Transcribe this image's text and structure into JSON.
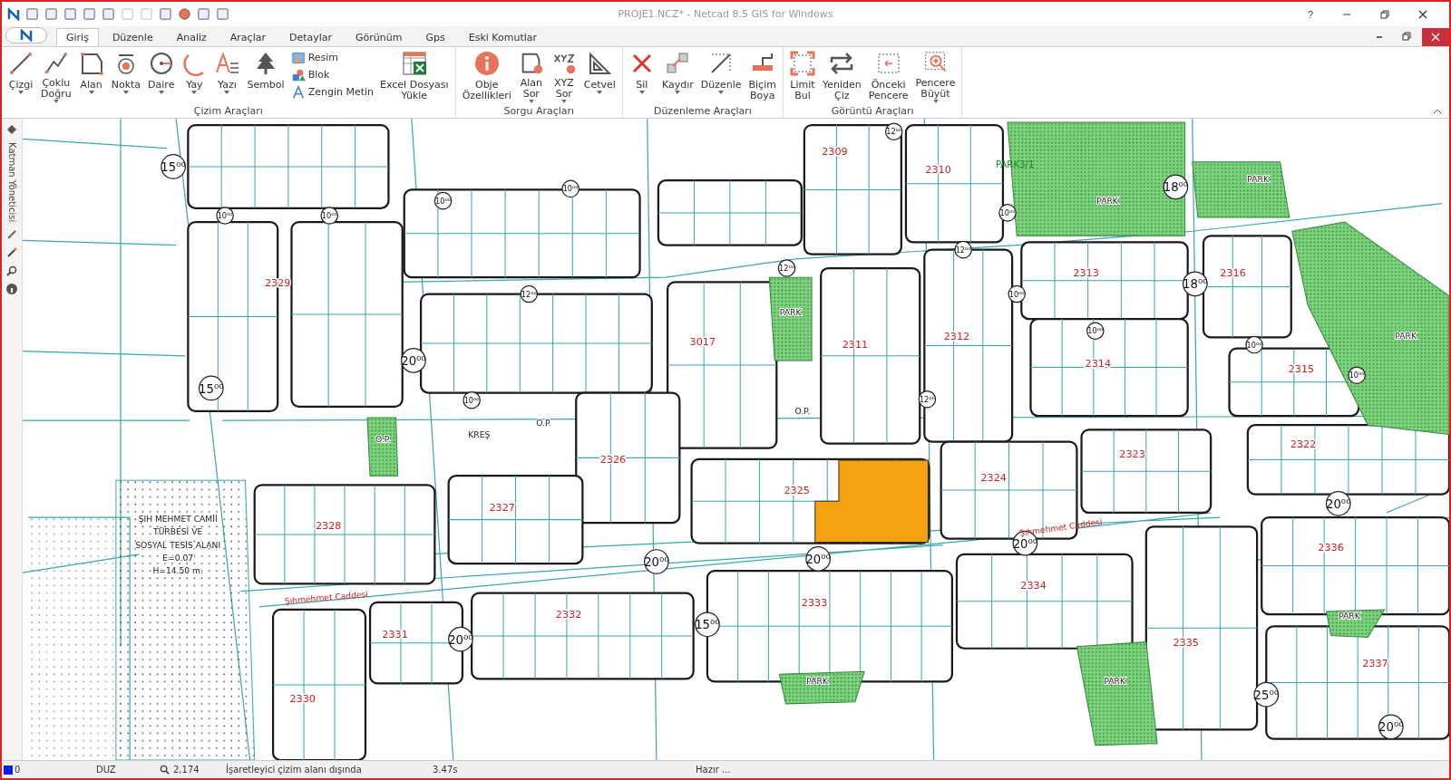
{
  "window": {
    "title": "PROJE1.NCZ* - Netcad 8.5 GIS for Windows",
    "help": "?"
  },
  "tabs": [
    {
      "label": "Giriş",
      "selected": true
    },
    {
      "label": "Düzenle",
      "selected": false
    },
    {
      "label": "Analiz",
      "selected": false
    },
    {
      "label": "Araçlar",
      "selected": false
    },
    {
      "label": "Detaylar",
      "selected": false
    },
    {
      "label": "Görünüm",
      "selected": false
    },
    {
      "label": "Gps",
      "selected": false
    },
    {
      "label": "Eski Komutlar",
      "selected": false
    }
  ],
  "ribbon": [
    {
      "label": "Çizim Araçları",
      "tools": [
        {
          "kind": "large",
          "lines": [
            "Çizgi"
          ],
          "dropdown": true
        },
        {
          "kind": "large",
          "lines": [
            "Çoklu",
            "Doğru"
          ],
          "dropdown": true
        },
        {
          "kind": "large",
          "lines": [
            "Alan"
          ],
          "dropdown": true
        },
        {
          "kind": "large",
          "lines": [
            "Nokta"
          ],
          "dropdown": true
        },
        {
          "kind": "large",
          "lines": [
            "Daire"
          ],
          "dropdown": true
        },
        {
          "kind": "large",
          "lines": [
            "Yay"
          ],
          "dropdown": true
        },
        {
          "kind": "large",
          "lines": [
            "Yazı"
          ],
          "dropdown": true
        },
        {
          "kind": "large",
          "lines": [
            "Sembol"
          ],
          "dropdown": false
        },
        {
          "kind": "small",
          "lines": [
            "Resim"
          ],
          "dropdown": false
        },
        {
          "kind": "small",
          "lines": [
            "Blok"
          ],
          "dropdown": false
        },
        {
          "kind": "small",
          "lines": [
            "Zengin Metin"
          ],
          "dropdown": false
        },
        {
          "kind": "large",
          "lines": [
            "Excel Dosyası",
            "Yükle"
          ],
          "dropdown": false
        }
      ]
    },
    {
      "label": "Sorgu Araçları",
      "tools": [
        {
          "kind": "large",
          "lines": [
            "Obje",
            "Özellikleri"
          ],
          "dropdown": false
        },
        {
          "kind": "large",
          "lines": [
            "Alan",
            "Sor"
          ],
          "dropdown": true
        },
        {
          "kind": "large",
          "lines": [
            "XYZ",
            "Sor"
          ],
          "dropdown": true
        },
        {
          "kind": "large",
          "lines": [
            "Cetvel"
          ],
          "dropdown": true
        }
      ]
    },
    {
      "label": "Düzenleme Araçları",
      "tools": [
        {
          "kind": "large",
          "lines": [
            "Sil"
          ],
          "dropdown": true
        },
        {
          "kind": "large",
          "lines": [
            "Kaydır"
          ],
          "dropdown": true
        },
        {
          "kind": "large",
          "lines": [
            "Düzenle"
          ],
          "dropdown": true
        },
        {
          "kind": "large",
          "lines": [
            "Biçim",
            "Boya"
          ],
          "dropdown": false
        }
      ]
    },
    {
      "label": "Görüntü Araçları",
      "tools": [
        {
          "kind": "large",
          "lines": [
            "Limit",
            "Bul"
          ],
          "dropdown": false
        },
        {
          "kind": "large",
          "lines": [
            "Yeniden",
            "Çiz"
          ],
          "dropdown": false
        },
        {
          "kind": "large",
          "lines": [
            "Önceki",
            "Pencere"
          ],
          "dropdown": false
        },
        {
          "kind": "large",
          "lines": [
            "Pencere",
            "Büyüt"
          ],
          "dropdown": true
        }
      ]
    }
  ],
  "side_panel": {
    "title": "Katman Yöneticisi"
  },
  "map": {
    "blocks": [
      {
        "highlighted": false
      },
      {
        "number": "2309",
        "highlighted": false
      },
      {
        "number": "2310",
        "highlighted": false
      },
      {
        "highlighted": false
      },
      {
        "highlighted": false
      },
      {
        "highlighted": false
      },
      {
        "number": "2329",
        "highlighted": false
      },
      {
        "number": "2313",
        "highlighted": false
      },
      {
        "number": "2316",
        "highlighted": false
      },
      {
        "number": "2312",
        "highlighted": false
      },
      {
        "number": "3017",
        "highlighted": false
      },
      {
        "number": "2311",
        "highlighted": false
      },
      {
        "highlighted": false
      },
      {
        "number": "2314",
        "highlighted": false
      },
      {
        "number": "2315",
        "highlighted": false
      },
      {
        "number": "2326",
        "highlighted": false
      },
      {
        "number": "2322",
        "highlighted": false
      },
      {
        "number": "2323",
        "highlighted": false
      },
      {
        "number": "2324",
        "highlighted": false
      },
      {
        "number": "2325",
        "highlighted": true
      },
      {
        "number": "2327",
        "highlighted": false
      },
      {
        "number": "2328",
        "highlighted": false
      },
      {
        "number": "2336",
        "highlighted": false
      },
      {
        "number": "2334",
        "highlighted": false
      },
      {
        "number": "2333",
        "highlighted": false
      },
      {
        "number": "2332",
        "highlighted": false
      },
      {
        "number": "2331",
        "highlighted": false
      },
      {
        "number": "2335",
        "highlighted": false
      },
      {
        "number": "2337",
        "highlighted": false
      },
      {
        "number": "2330",
        "highlighted": false
      }
    ],
    "parks": [
      {
        "label": "PARK"
      },
      {
        "label": "PARK"
      },
      {
        "label": "PARK"
      },
      {
        "label": "PARK"
      },
      {
        "label": "PARK"
      },
      {
        "label": "PARK"
      },
      {
        "label": "PARK"
      }
    ],
    "road_widths": [
      "15⁰⁰",
      "15⁰⁰",
      "15⁰⁰",
      "20⁰⁰",
      "20⁰⁰",
      "20⁰⁰",
      "20⁰⁰",
      "20⁰⁰",
      "20⁰⁰",
      "25⁰⁰",
      "20⁰⁰",
      "18⁰⁰",
      "18⁰⁰",
      "12⁰⁰",
      "12⁰⁰",
      "12⁰⁰",
      "12⁰⁰",
      "12⁰⁰",
      "10⁰⁰",
      "10⁰⁰",
      "10⁰⁰",
      "10⁰⁰",
      "10⁰⁰",
      "10⁰⁰",
      "10⁰⁰",
      "10⁰⁰",
      "10⁰⁰",
      "10⁰⁰"
    ],
    "streets": [
      "Şıhmehmet Caddesi",
      "Şıhmehmet Caddesi"
    ],
    "labels": [
      {
        "kind": "green",
        "text": "PARK3/1"
      },
      {
        "kind": "plain",
        "text": "O.P."
      },
      {
        "kind": "plain",
        "text": "O.P."
      },
      {
        "kind": "plain",
        "text": "O.P."
      },
      {
        "kind": "plain",
        "text": "KREŞ"
      },
      {
        "kind": "plain",
        "text": "ŞIH MEHMET CAMİİ"
      },
      {
        "kind": "plain",
        "text": "TÜRBESİ VE"
      },
      {
        "kind": "plain",
        "text": "SOSYAL TESİS ALANI"
      },
      {
        "kind": "plain",
        "text": "E=0.07"
      },
      {
        "kind": "plain",
        "text": "H=14.50 m."
      }
    ]
  },
  "status_bar": {
    "layer": "0",
    "mode": "DUZ",
    "zoom": "2,174",
    "message": "İşaretleyici çizim alanı dışında",
    "time": "3.47s",
    "state": "Hazır ..."
  }
}
